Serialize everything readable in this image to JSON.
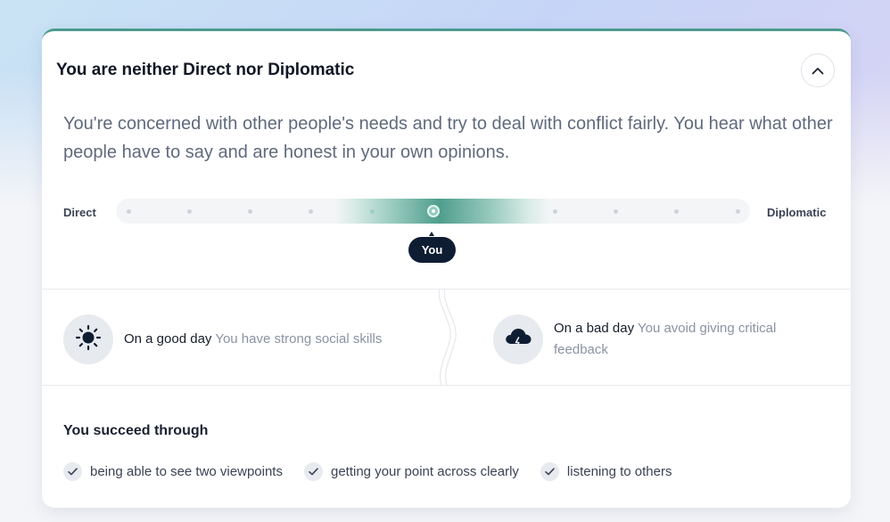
{
  "card": {
    "title": "You are neither Direct nor Diplomatic",
    "description": "You're concerned with other people's needs and try to deal with conflict fairly. You hear what other people have to say and are honest in your own opinions."
  },
  "scale": {
    "left_label": "Direct",
    "right_label": "Diplomatic",
    "steps": 11,
    "selected_step": 6,
    "you_label": "You",
    "accent_color": "#4f9e8e"
  },
  "days": {
    "good": {
      "icon": "sun-icon",
      "label": "On a good day",
      "text": "You have strong social skills"
    },
    "bad": {
      "icon": "storm-cloud-icon",
      "label": "On a bad day",
      "text": "You avoid giving critical feedback"
    }
  },
  "succeed": {
    "title": "You succeed through",
    "items": [
      "being able to see two viewpoints",
      "getting your point across clearly",
      "listening to others"
    ]
  },
  "colors": {
    "card_border": "#4c9b8e",
    "badge_bg": "#0f1d33"
  }
}
